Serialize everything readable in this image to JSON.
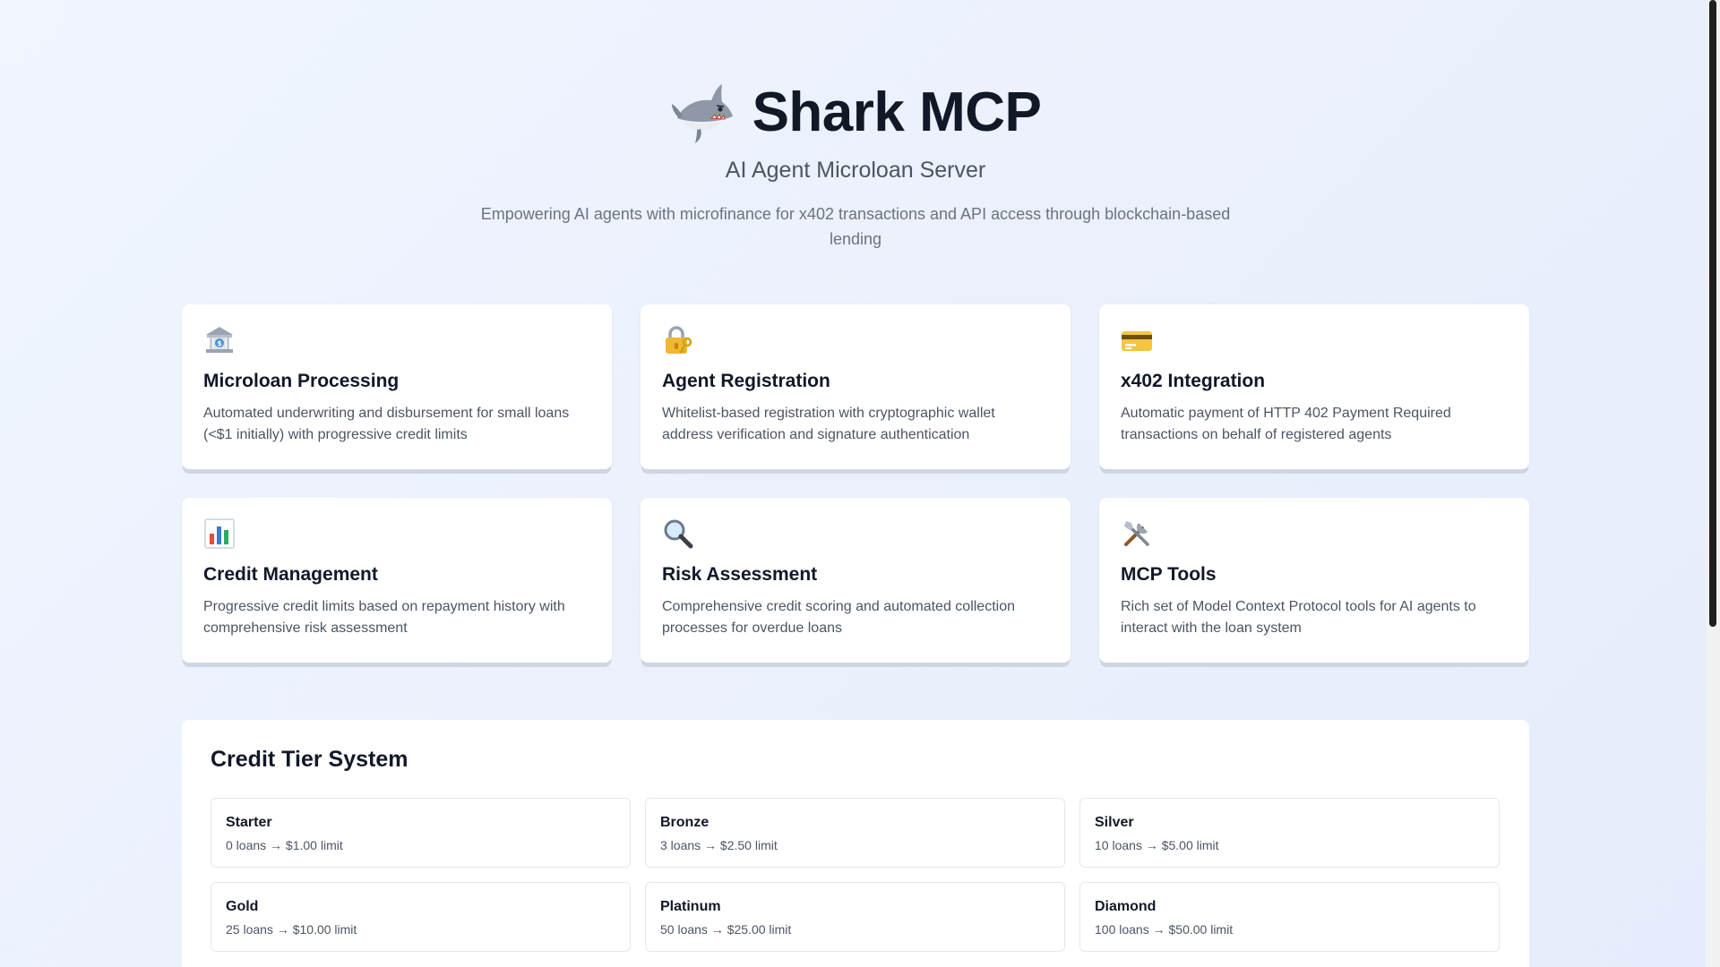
{
  "hero": {
    "logo_icon": "shark-icon",
    "title": "Shark MCP",
    "subtitle": "AI Agent Microloan Server",
    "description": "Empowering AI agents with microfinance for x402 transactions and API access through blockchain-based lending"
  },
  "features": [
    {
      "icon": "bank-icon",
      "title": "Microloan Processing",
      "description": "Automated underwriting and disbursement for small loans (<$1 initially) with progressive credit limits"
    },
    {
      "icon": "lock-key-icon",
      "title": "Agent Registration",
      "description": "Whitelist-based registration with cryptographic wallet address verification and signature authentication"
    },
    {
      "icon": "credit-card-icon",
      "title": "x402 Integration",
      "description": "Automatic payment of HTTP 402 Payment Required transactions on behalf of registered agents"
    },
    {
      "icon": "bar-chart-icon",
      "title": "Credit Management",
      "description": "Progressive credit limits based on repayment history with comprehensive risk assessment"
    },
    {
      "icon": "magnifier-icon",
      "title": "Risk Assessment",
      "description": "Comprehensive credit scoring and automated collection processes for overdue loans"
    },
    {
      "icon": "tools-icon",
      "title": "MCP Tools",
      "description": "Rich set of Model Context Protocol tools for AI agents to interact with the loan system"
    }
  ],
  "credit_tiers": {
    "title": "Credit Tier System",
    "tiers": [
      {
        "name": "Starter",
        "detail": "0 loans → $1.00 limit"
      },
      {
        "name": "Bronze",
        "detail": "3 loans → $2.50 limit"
      },
      {
        "name": "Silver",
        "detail": "10 loans → $5.00 limit"
      },
      {
        "name": "Gold",
        "detail": "25 loans → $10.00 limit"
      },
      {
        "name": "Platinum",
        "detail": "50 loans → $25.00 limit"
      },
      {
        "name": "Diamond",
        "detail": "100 loans → $50.00 limit"
      }
    ]
  },
  "colors": {
    "background": "#eef2fd",
    "card": "#ffffff",
    "heading": "#111827",
    "body_text": "#4b5563"
  }
}
